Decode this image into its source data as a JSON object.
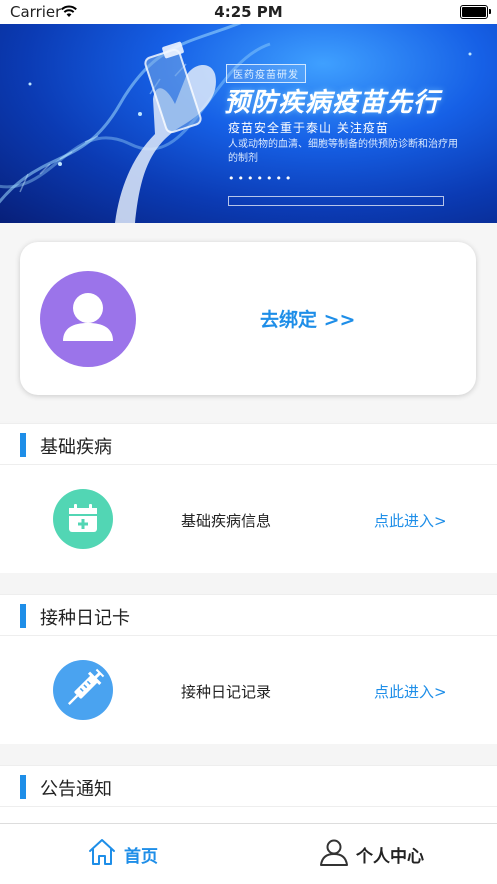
{
  "status_bar": {
    "carrier": "Carrier",
    "time": "4:25 PM"
  },
  "banner": {
    "tag": "医药疫苗研发",
    "headline": "预防疾病疫苗先行",
    "subline": "疫苗安全重于泰山  关注疫苗",
    "description": "人或动物的血清、细胞等制备的供预防诊断和治疗用的制剂",
    "dots": "•••••••"
  },
  "bind_card": {
    "link": "去绑定 >>"
  },
  "sections": [
    {
      "title": "基础疾病",
      "row_label": "基础疾病信息",
      "enter": "点此进入>",
      "icon": "calendar-add-icon",
      "icon_color": "#52d6b4"
    },
    {
      "title": "接种日记卡",
      "row_label": "接种日记记录",
      "enter": "点此进入>",
      "icon": "syringe-icon",
      "icon_color": "#4aa3f0"
    },
    {
      "title": "公告通知"
    }
  ],
  "tabbar": {
    "home": {
      "label": "首页",
      "icon": "home-icon"
    },
    "user": {
      "label": "个人中心",
      "icon": "person-icon"
    }
  },
  "colors": {
    "accent": "#1e8ee8",
    "avatar_bg": "#9b74ea"
  }
}
